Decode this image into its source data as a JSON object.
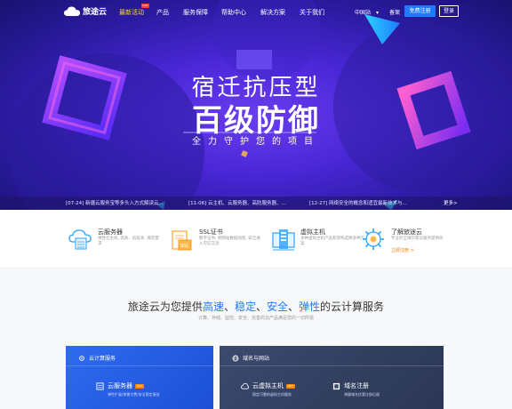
{
  "nav": {
    "logo_text": "旅途云",
    "items": [
      "最新活动",
      "产品",
      "服务保障",
      "帮助中心",
      "解决方案",
      "关于我们"
    ],
    "hot_badge": "HOT",
    "region": "中国站",
    "record": "备案",
    "register": "免费注册",
    "login": "登录"
  },
  "hero": {
    "title_line1": "宿迁抗压型",
    "title_line2": "百级防御",
    "subtitle": "全力守护您的项目"
  },
  "news": {
    "items": [
      "[07-24] 新疆云服务宝等多头入方式解读云...",
      "[11-06] 云主机、云服务器、高防服务器、...",
      "[12-27] 网络安全的概念和适宜最新技术与..."
    ],
    "more": "更多>"
  },
  "features": [
    {
      "title": "云服务器",
      "desc": "弹性云主机, 高防、低延本, 满足需求",
      "icon": "cloud-server-icon"
    },
    {
      "title": "SSL证书",
      "desc": "数字证书, 给网站数据加密, 安全通入可信交流",
      "icon": "ssl-certificate-icon"
    },
    {
      "title": "虚拟主机",
      "desc": "多种虚拟主机产品和架构选择多种方案",
      "icon": "virtual-host-icon"
    },
    {
      "title": "了解旅途云",
      "desc": "专业的全球可靠云服务提供商",
      "link": "立即注册 >",
      "icon": "about-gear-icon"
    }
  ],
  "main": {
    "title_prefix": "旅途云为您提供",
    "hl1": "高速",
    "sep1": "、",
    "hl2": "稳定",
    "sep2": "、",
    "hl3": "安全",
    "sep3": "、",
    "hl4": "弹性",
    "title_suffix": "的云计算服务",
    "subtitle": "计算、存储、监控、安全、完善的云产品满足您的一切所需",
    "cards": [
      {
        "head": "云计算服务",
        "products": [
          {
            "name": "云服务器",
            "badge": "HOT",
            "desc": "弹性扩展/按需付费/安全稳定服务"
          }
        ]
      },
      {
        "head": "域名与网站",
        "products": [
          {
            "name": "云虚拟主机",
            "badge": "HOT",
            "desc": "稳定可靠的虚拟主机服务"
          },
          {
            "name": "域名注册",
            "desc": "海量域名优惠注册后缀"
          }
        ]
      }
    ]
  }
}
